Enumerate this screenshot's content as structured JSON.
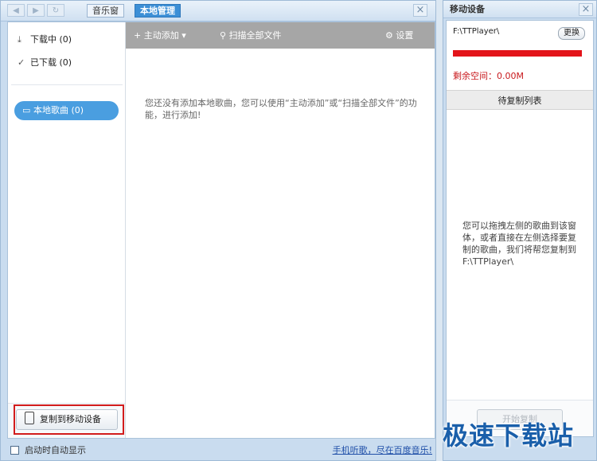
{
  "topbar": {
    "back_icon": "arrow-left-icon",
    "forward_icon": "arrow-right-icon",
    "refresh_icon": "refresh-icon",
    "tabs": [
      {
        "label": "音乐窗"
      },
      {
        "label": "本地管理",
        "active": true
      }
    ],
    "close_label": "×"
  },
  "sidebar": {
    "items": [
      {
        "label": "下载中 (0)",
        "icon": "download-icon"
      },
      {
        "label": "已下载 (0)",
        "icon": "check-icon"
      }
    ],
    "local_songs": {
      "label": "本地歌曲 (0)",
      "icon": "monitor-icon"
    },
    "copy_button": {
      "label": "复制到移动设备",
      "icon": "phone-icon"
    }
  },
  "toolbar": {
    "add_label": "主动添加",
    "scan_label": "扫描全部文件",
    "settings_label": "设置"
  },
  "main": {
    "empty_message": "您还没有添加本地歌曲，您可以使用“主动添加”或“扫描全部文件”的功能，进行添加!"
  },
  "statusbar": {
    "autostart_label": "启动时自动显示",
    "autostart_checked": false,
    "link_text": "手机听歌，尽在百度音乐!"
  },
  "device": {
    "title": "移动设备",
    "close_label": "×",
    "path": "F:\\TTPlayer\\",
    "change_label": "更换",
    "capacity_used_fraction": 1.0,
    "free_space": "剩余空间：0.00M",
    "pending_header": "待复制列表",
    "tip": "您可以拖拽左侧的歌曲到该窗体，或者直接在左侧选择要复制的歌曲，我们将帮您复制到F:\\TTPlayer\\",
    "start_copy_label": "开始复制"
  },
  "watermark": "极速下载站",
  "colors": {
    "accent": "#4a9ee0",
    "highlight_box": "#d21c1c",
    "capacity_bar": "#e3141a",
    "free_space_text": "#c8181c"
  }
}
